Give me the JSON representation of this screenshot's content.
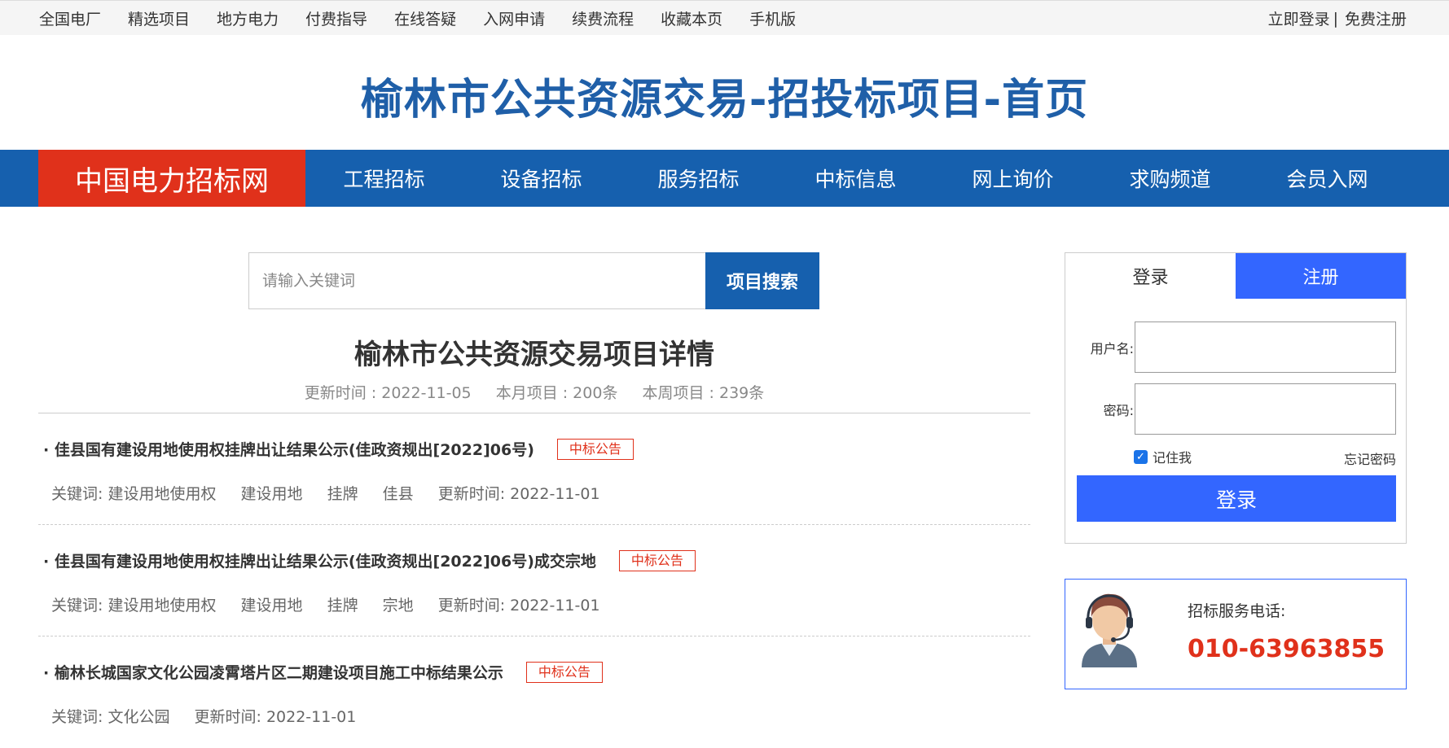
{
  "topbar": {
    "links": [
      "全国电厂",
      "精选项目",
      "地方电力",
      "付费指导",
      "在线答疑",
      "入网申请",
      "续费流程",
      "收藏本页",
      "手机版"
    ],
    "login": "立即登录",
    "separator": "|",
    "register": "免费注册"
  },
  "header": {
    "title": "榆林市公共资源交易-招投标项目-首页"
  },
  "nav": {
    "brand": "中国电力招标网",
    "items": [
      "工程招标",
      "设备招标",
      "服务招标",
      "中标信息",
      "网上询价",
      "求购频道",
      "会员入网"
    ]
  },
  "search": {
    "placeholder": "请输入关键词",
    "button": "项目搜索"
  },
  "detail": {
    "title": "榆林市公共资源交易项目详情",
    "updated": "更新时间 : 2022-11-05",
    "month": "本月项目 : 200条",
    "week": "本周项目 : 239条"
  },
  "list": [
    {
      "title": "· 佳县国有建设用地使用权挂牌出让结果公示(佳政资规出[2022]06号)",
      "badge": "中标公告",
      "keywords_label": "关键词: 建设用地使用权",
      "keywords": [
        "建设用地",
        "挂牌",
        "佳县"
      ],
      "updated": "更新时间:  2022-11-01"
    },
    {
      "title": "· 佳县国有建设用地使用权挂牌出让结果公示(佳政资规出[2022]06号)成交宗地",
      "badge": "中标公告",
      "keywords_label": "关键词: 建设用地使用权",
      "keywords": [
        "建设用地",
        "挂牌",
        "宗地"
      ],
      "updated": "更新时间:  2022-11-01"
    },
    {
      "title": "· 榆林长城国家文化公园凌霄塔片区二期建设项目施工中标结果公示",
      "badge": "中标公告",
      "keywords_label": "关键词: 文化公园",
      "keywords": [],
      "updated": "更新时间:  2022-11-01"
    }
  ],
  "login_box": {
    "tab_login": "登录",
    "tab_register": "注册",
    "username_label": "用户名:",
    "password_label": "密码:",
    "remember": "记住我",
    "forgot": "忘记密码",
    "submit": "登录"
  },
  "service": {
    "label": "招标服务电话:",
    "phone": "010-63963855"
  },
  "colors": {
    "brand_blue": "#1660ae",
    "brand_red": "#e0311b",
    "accent_blue": "#3366ff"
  }
}
